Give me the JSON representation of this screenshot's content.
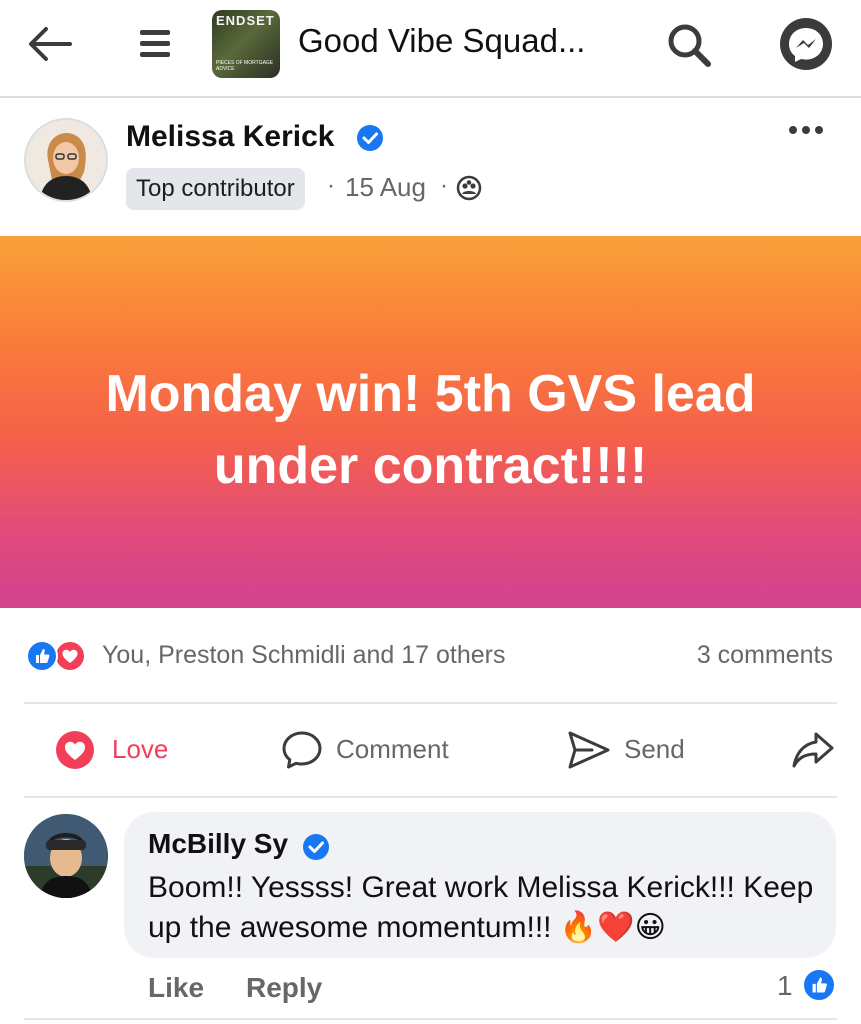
{
  "header": {
    "group_name": "Good Vibe Squad...",
    "group_thumb_text": "ENDSET",
    "group_thumb_subtext": "PIECES OF MORTGAGE ADVICE"
  },
  "post": {
    "author": "Melissa Kerick",
    "badge": "Top contributor",
    "dot": "·",
    "date": "15 Aug",
    "banner_text": "Monday win! 5th GVS lead under contract!!!!",
    "reactions_text": "You, Preston Schmidli and 17 others",
    "comments_count": "3 comments"
  },
  "actions": {
    "love": "Love",
    "comment": "Comment",
    "send": "Send"
  },
  "comment": {
    "name": "McBilly Sy",
    "text": "Boom!! Yessss! Great work Melissa Kerick!!! Keep up the awesome momentum!!! 🔥❤️😀",
    "like_label": "Like",
    "reply_label": "Reply",
    "like_count": "1"
  },
  "colors": {
    "facebook_blue": "#1877f2",
    "love_red": "#f33e58",
    "banner_top": "#f9a13a",
    "banner_bottom": "#d1428e"
  }
}
